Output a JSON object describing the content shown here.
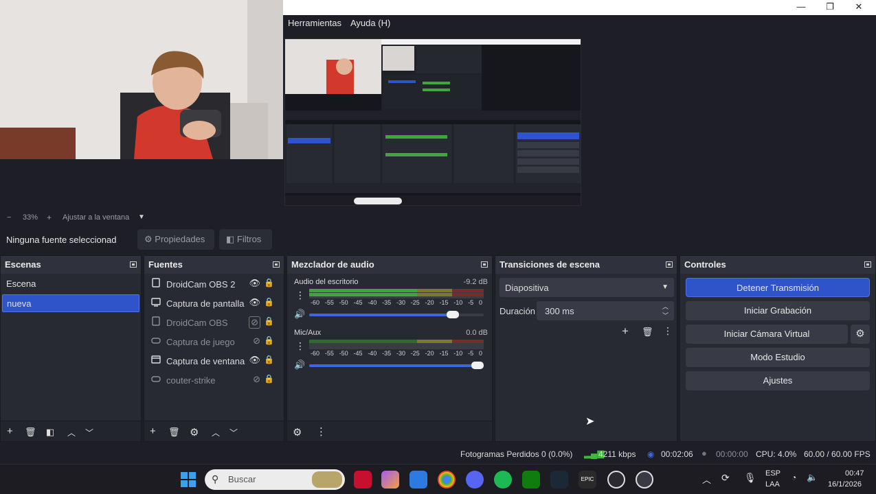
{
  "window": {
    "menu": [
      "Herramientas",
      "Ayuda (H)"
    ],
    "minimize": "—",
    "maximize": "❐",
    "close": "✕"
  },
  "zoom": {
    "minus": "−",
    "value": "33%",
    "plus": "+",
    "fit": "Ajustar a la ventana"
  },
  "source_toolbar": {
    "no_source": "Ninguna fuente seleccionad",
    "properties": "Propiedades",
    "filters": "Filtros"
  },
  "scenes": {
    "title": "Escenas",
    "items": [
      {
        "label": "Escena",
        "selected": false
      },
      {
        "label": "nueva",
        "selected": true
      }
    ]
  },
  "sources": {
    "title": "Fuentes",
    "items": [
      {
        "label": "DroidCam OBS 2",
        "icon": "camera-icon",
        "visible": true
      },
      {
        "label": "Captura de pantalla",
        "icon": "monitor-icon",
        "visible": true
      },
      {
        "label": "DroidCam OBS",
        "icon": "camera-icon",
        "visible": false
      },
      {
        "label": "Captura de juego",
        "icon": "gamepad-icon",
        "visible": false
      },
      {
        "label": "Captura de ventana",
        "icon": "window-icon",
        "visible": true
      },
      {
        "label": "couter-strike",
        "icon": "gamepad-icon",
        "visible": false
      }
    ]
  },
  "mixer": {
    "title": "Mezclador de audio",
    "scale": [
      "-60",
      "-55",
      "-50",
      "-45",
      "-40",
      "-35",
      "-30",
      "-25",
      "-20",
      "-15",
      "-10",
      "-5",
      "0"
    ],
    "channels": [
      {
        "name": "Audio del escritorio",
        "db": "-9.2 dB",
        "level": 0.86
      },
      {
        "name": "Mic/Aux",
        "db": "0.0 dB",
        "level": 1.0
      }
    ]
  },
  "transitions": {
    "title": "Transiciones de escena",
    "selected": "Diapositiva",
    "duration_label": "Duración",
    "duration_value": "300 ms"
  },
  "controls": {
    "title": "Controles",
    "stop_stream": "Detener Transmisión",
    "start_recording": "Iniciar Grabación",
    "start_virtual_cam": "Iniciar Cámara Virtual",
    "studio_mode": "Modo Estudio",
    "settings": "Ajustes"
  },
  "status": {
    "dropped_frames": "Fotogramas Perdidos 0 (0.0%)",
    "bitrate": "4211 kbps",
    "stream_time": "00:02:06",
    "record_time": "00:00:00",
    "cpu": "CPU: 4.0%",
    "fps": "60.00 / 60.00 FPS"
  },
  "taskbar": {
    "search_placeholder": "Buscar",
    "lang_top": "ESP",
    "lang_bottom": "LAA",
    "time": "00:47",
    "date": "16/1/2026"
  },
  "colors": {
    "accent": "#2f54c9",
    "panel": "#272a33",
    "background": "#1e1f26"
  }
}
